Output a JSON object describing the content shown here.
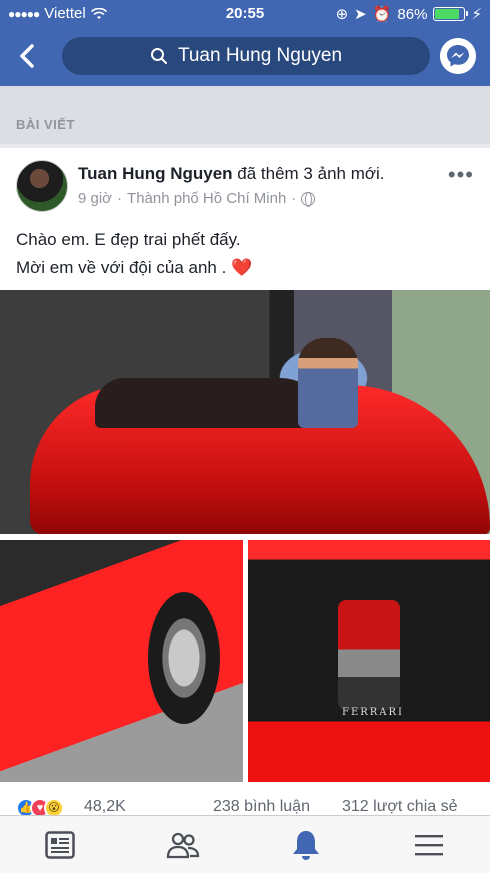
{
  "status_bar": {
    "carrier": "Viettel",
    "time": "20:55",
    "battery": "86%",
    "battery_level": 0.86
  },
  "nav": {
    "search_text": "Tuan Hung Nguyen"
  },
  "section": {
    "title": "BÀI VIẾT"
  },
  "post": {
    "author": "Tuan Hung Nguyen",
    "action": " đã thêm 3 ảnh mới.",
    "time": "9 giờ",
    "separator": "·",
    "location": "Thành phố Hồ Chí Minh",
    "text_line1": "Chào em. E đẹp trai phết đấy.",
    "text_line2": "Mời em về với đội của anh . ",
    "heart": "❤️",
    "photo_badge": "FERRARI",
    "reaction_count": "48,2K",
    "comments": "238 bình luận",
    "shares": "312 lượt chia sẻ"
  },
  "tabs": [
    {
      "name": "news-feed",
      "icon": "news-feed-icon"
    },
    {
      "name": "friends",
      "icon": "friends-icon"
    },
    {
      "name": "notifications",
      "icon": "bell-icon",
      "active": true
    },
    {
      "name": "menu",
      "icon": "menu-icon"
    }
  ],
  "colors": {
    "brand": "#4267b2",
    "active_tab": "#4267b2",
    "inactive_tab": "#4b4f56"
  }
}
